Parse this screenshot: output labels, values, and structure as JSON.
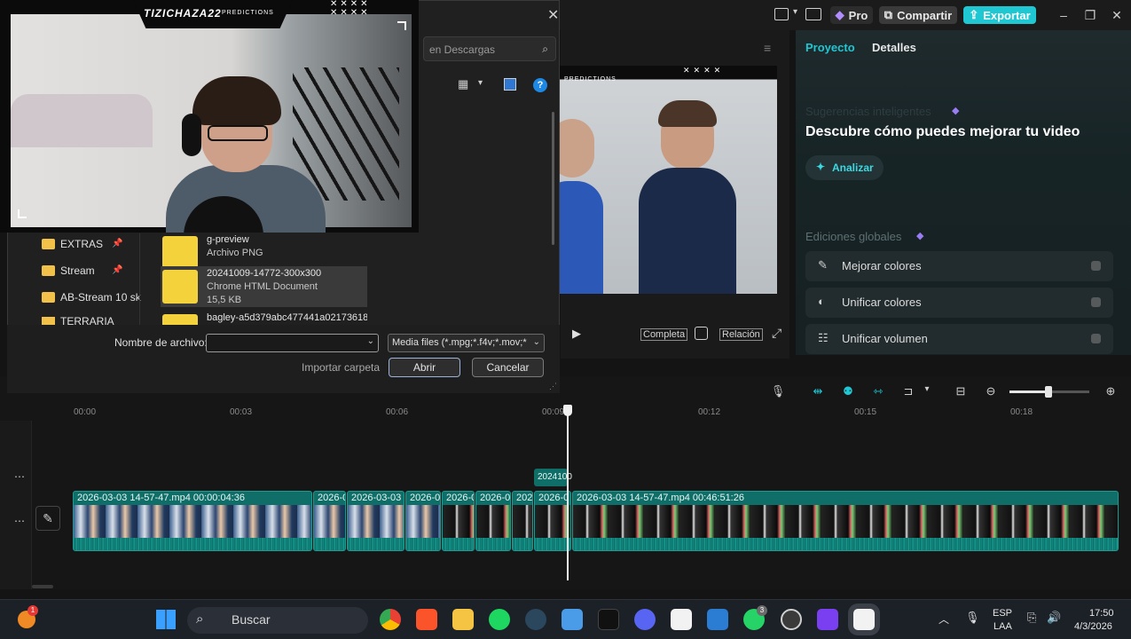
{
  "app": {
    "pro_label": "Pro",
    "share_label": "Compartir",
    "export_label": "Exportar"
  },
  "preview": {
    "overlay_tag": "PREDICTIONS",
    "full_label": "Completa",
    "ratio_label": "Relación"
  },
  "right_panel": {
    "tabs": [
      "Proyecto",
      "Detalles"
    ],
    "suggestions_title": "Sugerencias inteligentes",
    "headline": "Descubre cómo puedes mejorar tu video",
    "analyze_label": "Analizar",
    "global_edits_title": "Ediciones globales",
    "items": [
      {
        "label": "Mejorar colores"
      },
      {
        "label": "Unificar colores"
      },
      {
        "label": "Unificar volumen"
      }
    ]
  },
  "timeline": {
    "ticks": [
      "00:00",
      "00:03",
      "00:06",
      "00:09",
      "00:12",
      "00:15",
      "00:18"
    ],
    "marker_label": "2024100",
    "clips": [
      {
        "label": "2026-03-03 14-57-47.mp4   00:00:04:36"
      },
      {
        "label": "2026-0"
      },
      {
        "label": "2026-03-03"
      },
      {
        "label": "2026-0"
      },
      {
        "label": "2026-0"
      },
      {
        "label": "2026-0"
      },
      {
        "label": "202"
      },
      {
        "label": "2026-0"
      },
      {
        "label": "2026-03-03 14-57-47.mp4   00:46:51:26"
      }
    ]
  },
  "file_dialog": {
    "search_placeholder": "en Descargas",
    "nav": [
      {
        "label": "EXTRAS",
        "pinned": true
      },
      {
        "label": "Stream",
        "pinned": true
      },
      {
        "label": "AB-Stream 10 sk",
        "pinned": false
      },
      {
        "label": "TERRARIA",
        "pinned": false
      }
    ],
    "files": [
      {
        "name": "g-preview",
        "type": "Archivo PNG",
        "size": ""
      },
      {
        "name": "20241009-14772-300x300",
        "type": "Chrome HTML Document",
        "size": "15,5 KB"
      },
      {
        "name": "bagley-a5d379abc477441a02173618",
        "type": "",
        "size": ""
      }
    ],
    "filename_label": "Nombre de archivo:",
    "filename_value": "",
    "filetype": "Media files (*.mpg;*.f4v;*.mov;*",
    "import_folder_label": "Importar carpeta",
    "open_label": "Abrir",
    "cancel_label": "Cancelar"
  },
  "webcam": {
    "channel": "TIZICHAZA22",
    "tag": "PREDICTIONS"
  },
  "taskbar": {
    "search_label": "Buscar",
    "lang_top": "ESP",
    "lang_bottom": "LAA",
    "time": "17:50",
    "date": "4/3/2026",
    "notification_badge": "1",
    "whatsapp_badge": "3"
  },
  "colors": {
    "accent": "#1fc7d3",
    "clip": "#0f6e68",
    "folder": "#f2c14a"
  }
}
